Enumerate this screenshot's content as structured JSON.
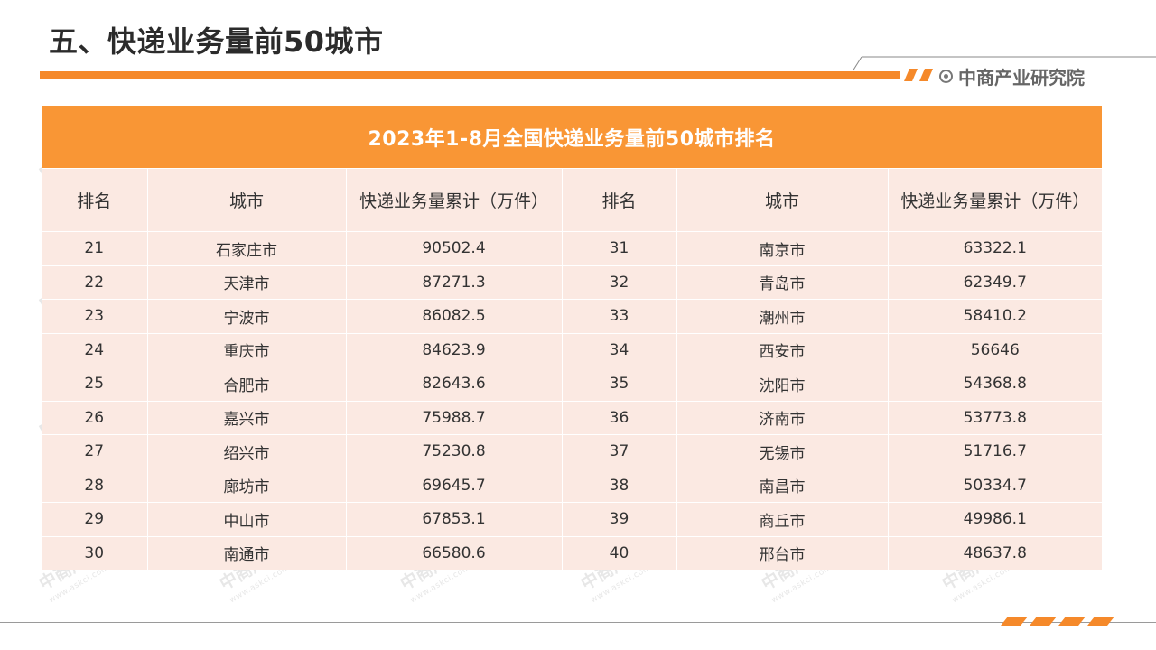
{
  "header": {
    "title": "五、快递业务量前50城市",
    "brand": "中商产业研究院"
  },
  "table": {
    "title": "2023年1-8月全国快递业务量前50城市排名",
    "headers": [
      "排名",
      "城市",
      "快递业务量累计（万件）",
      "排名",
      "城市",
      "快递业务量累计（万件）"
    ],
    "rows": [
      {
        "rank_left": "21",
        "city_left": "石家庄市",
        "value_left": "90502.4",
        "rank_right": "31",
        "city_right": "南京市",
        "value_right": "63322.1"
      },
      {
        "rank_left": "22",
        "city_left": "天津市",
        "value_left": "87271.3",
        "rank_right": "32",
        "city_right": "青岛市",
        "value_right": "62349.7"
      },
      {
        "rank_left": "23",
        "city_left": "宁波市",
        "value_left": "86082.5",
        "rank_right": "33",
        "city_right": "潮州市",
        "value_right": "58410.2"
      },
      {
        "rank_left": "24",
        "city_left": "重庆市",
        "value_left": "84623.9",
        "rank_right": "34",
        "city_right": "西安市",
        "value_right": "56646"
      },
      {
        "rank_left": "25",
        "city_left": "合肥市",
        "value_left": "82643.6",
        "rank_right": "35",
        "city_right": "沈阳市",
        "value_right": "54368.8"
      },
      {
        "rank_left": "26",
        "city_left": "嘉兴市",
        "value_left": "75988.7",
        "rank_right": "36",
        "city_right": "济南市",
        "value_right": "53773.8"
      },
      {
        "rank_left": "27",
        "city_left": "绍兴市",
        "value_left": "75230.8",
        "rank_right": "37",
        "city_right": "无锡市",
        "value_right": "51716.7"
      },
      {
        "rank_left": "28",
        "city_left": "廊坊市",
        "value_left": "69645.7",
        "rank_right": "38",
        "city_right": "南昌市",
        "value_right": "50334.7"
      },
      {
        "rank_left": "29",
        "city_left": "中山市",
        "value_left": "67853.1",
        "rank_right": "39",
        "city_right": "商丘市",
        "value_right": "49986.1"
      },
      {
        "rank_left": "30",
        "city_left": "南通市",
        "value_left": "66580.6",
        "rank_right": "40",
        "city_right": "邢台市",
        "value_right": "48637.8"
      }
    ]
  },
  "watermark": {
    "text": "中商产业研究院",
    "url": "www.askci.com/reports"
  },
  "colors": {
    "accent": "#f5892a",
    "table_title_bg": "#f99635",
    "table_cell_bg": "#fbe9e2"
  }
}
